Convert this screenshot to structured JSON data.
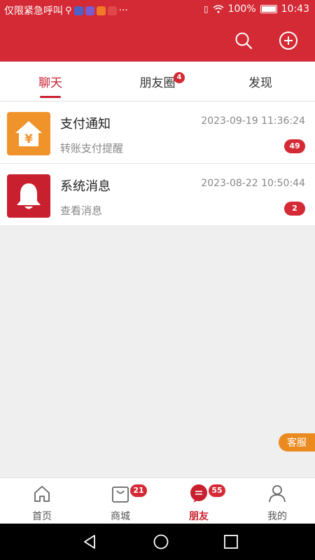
{
  "status_bar": {
    "left_text": "仅限紧急呼叫",
    "battery": "100%",
    "time": "10:43",
    "more": "···"
  },
  "colors": {
    "brand": "#d42a35",
    "accent_orange": "#eb8a1f",
    "badge": "#d42a35"
  },
  "header": {
    "icons": [
      "search-icon",
      "add-circle-icon"
    ]
  },
  "tabs": [
    {
      "label": "聊天",
      "active": true
    },
    {
      "label": "朋友圈",
      "badge": "4"
    },
    {
      "label": "发现"
    }
  ],
  "conversations": [
    {
      "title": "支付通知",
      "time": "2023-09-19 11:36:24",
      "preview": "转账支付提醒",
      "count": "49",
      "icon": "yuan-house-icon"
    },
    {
      "title": "系统消息",
      "time": "2023-08-22 10:50:44",
      "preview": "查看消息",
      "count": "2",
      "icon": "bell-icon"
    }
  ],
  "floating": {
    "service_label": "客服"
  },
  "bottom_nav": [
    {
      "label": "首页",
      "icon": "home-icon"
    },
    {
      "label": "商城",
      "icon": "shopping-bag-icon",
      "badge": "21"
    },
    {
      "label": "朋友",
      "icon": "chat-bubble-icon",
      "badge": "55",
      "active": true
    },
    {
      "label": "我的",
      "icon": "user-icon"
    }
  ]
}
